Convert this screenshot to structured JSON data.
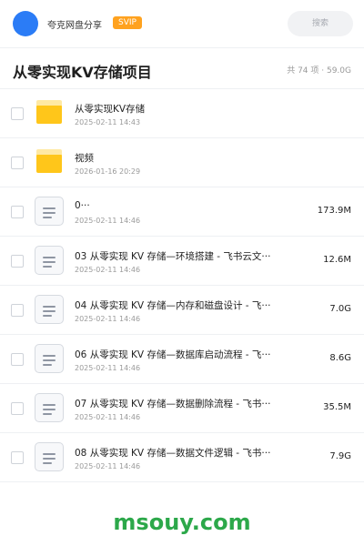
{
  "header": {
    "share_name": "夸克网盘分享",
    "vip_label": "SVIP",
    "search_placeholder": "搜索"
  },
  "title_bar": {
    "title": "从零实现KV存储项目",
    "summary": "共 74 项 · 59.0G"
  },
  "files": [
    {
      "type": "folder",
      "name": "从零实现KV存储",
      "date": "2025-02-11 14:43",
      "size": ""
    },
    {
      "type": "folder",
      "name": "视频",
      "date": "2026-01-16 20:29",
      "size": ""
    },
    {
      "type": "file",
      "name": "0···",
      "date": "2025-02-11 14:46",
      "size": "173.9M"
    },
    {
      "type": "file",
      "name": "03 从零实现 KV 存储—环境搭建 - 飞书云文···",
      "date": "2025-02-11 14:46",
      "size": "12.6M"
    },
    {
      "type": "file",
      "name": "04 从零实现 KV 存储—内存和磁盘设计 - 飞···",
      "date": "2025-02-11 14:46",
      "size": "7.0G"
    },
    {
      "type": "file",
      "name": "06 从零实现 KV 存储—数据库启动流程 - 飞···",
      "date": "2025-02-11 14:46",
      "size": "8.6G"
    },
    {
      "type": "file",
      "name": "07 从零实现 KV 存储—数据删除流程 - 飞书···",
      "date": "2025-02-11 14:46",
      "size": "35.5M"
    },
    {
      "type": "file",
      "name": "08 从零实现 KV 存储—数据文件逻辑 - 飞书···",
      "date": "2025-02-11 14:46",
      "size": "7.9G"
    }
  ],
  "watermark": "msouy.com",
  "colors": {
    "avatar": "#2b7cf6",
    "vip_badge": "#ffa21f",
    "folder": "#ffc61a",
    "watermark": "#2ca84a"
  }
}
